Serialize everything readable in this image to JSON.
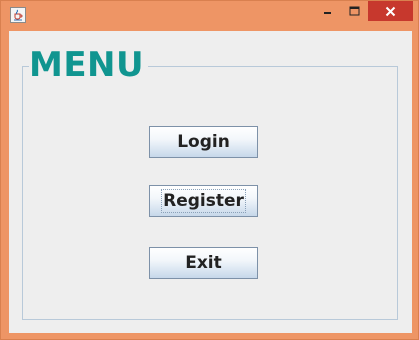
{
  "window": {
    "controls": {
      "minimize_icon": "minimize-icon",
      "maximize_icon": "maximize-icon",
      "close_icon": "close-icon"
    },
    "app_icon": "java-cup-icon"
  },
  "group": {
    "title": "MENU",
    "title_color": "#109590"
  },
  "buttons": {
    "login": "Login",
    "register": "Register",
    "exit": "Exit"
  },
  "colors": {
    "frame": "#ee9565",
    "close_button": "#c7382d",
    "client_background": "#eeeeee"
  }
}
